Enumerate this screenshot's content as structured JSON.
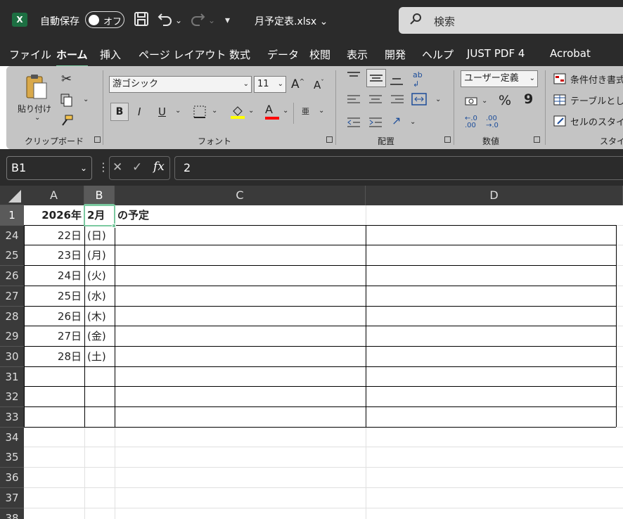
{
  "titlebar": {
    "app_icon": "X",
    "autosave_label": "自動保存",
    "autosave_state": "オフ",
    "filename": "月予定表.xlsx",
    "filename_chevron": "⌄",
    "search_placeholder": "検索",
    "icons": [
      "save-icon",
      "undo-icon",
      "redo-icon",
      "customize-quick-access-icon",
      "search-icon"
    ]
  },
  "menu": {
    "tabs": [
      "ファイル",
      "ホーム",
      "挿入",
      "ページ レイアウト",
      "数式",
      "データ",
      "校閲",
      "表示",
      "開発",
      "ヘルプ",
      "JUST PDF 4",
      "Acrobat"
    ],
    "active": "ホーム"
  },
  "ribbon": {
    "clipboard": {
      "paste_label": "貼り付け",
      "group_label": "クリップボード"
    },
    "font": {
      "font_name": "游ゴシック",
      "font_size": "11",
      "bold": "B",
      "italic": "I",
      "underline": "U",
      "grow": "A",
      "shrink": "A",
      "font_color": "A",
      "furigana": "亜",
      "group_label": "フォント",
      "fill_color": "#ffff00",
      "font_color_value": "#ff0000"
    },
    "alignment": {
      "group_label": "配置"
    },
    "number": {
      "format": "ユーザー定義",
      "percent": "%",
      "comma": "9",
      "group_label": "数値"
    },
    "styles": {
      "conditional": "条件付き書式",
      "table": "テーブルとして",
      "cell_styles": "セルのスタイル",
      "group_label": "スタイル"
    }
  },
  "formula_bar": {
    "name_box": "B1",
    "cancel": "✕",
    "enter": "✓",
    "fx": "fx",
    "value": "2"
  },
  "sheet": {
    "columns": [
      "A",
      "B",
      "C",
      "D"
    ],
    "selected_column": "B",
    "rows": [
      {
        "num": "1",
        "a": "2026年",
        "b": "2月",
        "c": "の予定"
      },
      {
        "num": "24",
        "a": "22日",
        "b": "(日)",
        "c": ""
      },
      {
        "num": "25",
        "a": "23日",
        "b": "(月)",
        "c": ""
      },
      {
        "num": "26",
        "a": "24日",
        "b": "(火)",
        "c": ""
      },
      {
        "num": "27",
        "a": "25日",
        "b": "(水)",
        "c": ""
      },
      {
        "num": "28",
        "a": "26日",
        "b": "(木)",
        "c": ""
      },
      {
        "num": "29",
        "a": "27日",
        "b": "(金)",
        "c": ""
      },
      {
        "num": "30",
        "a": "28日",
        "b": "(土)",
        "c": ""
      },
      {
        "num": "31",
        "a": "",
        "b": "",
        "c": ""
      },
      {
        "num": "32",
        "a": "",
        "b": "",
        "c": ""
      },
      {
        "num": "33",
        "a": "",
        "b": "",
        "c": ""
      },
      {
        "num": "34",
        "a": "",
        "b": "",
        "c": ""
      },
      {
        "num": "35",
        "a": "",
        "b": "",
        "c": ""
      },
      {
        "num": "36",
        "a": "",
        "b": "",
        "c": ""
      },
      {
        "num": "37",
        "a": "",
        "b": "",
        "c": ""
      },
      {
        "num": "38",
        "a": "",
        "b": "",
        "c": ""
      }
    ],
    "accent": "#7bc9a0"
  }
}
